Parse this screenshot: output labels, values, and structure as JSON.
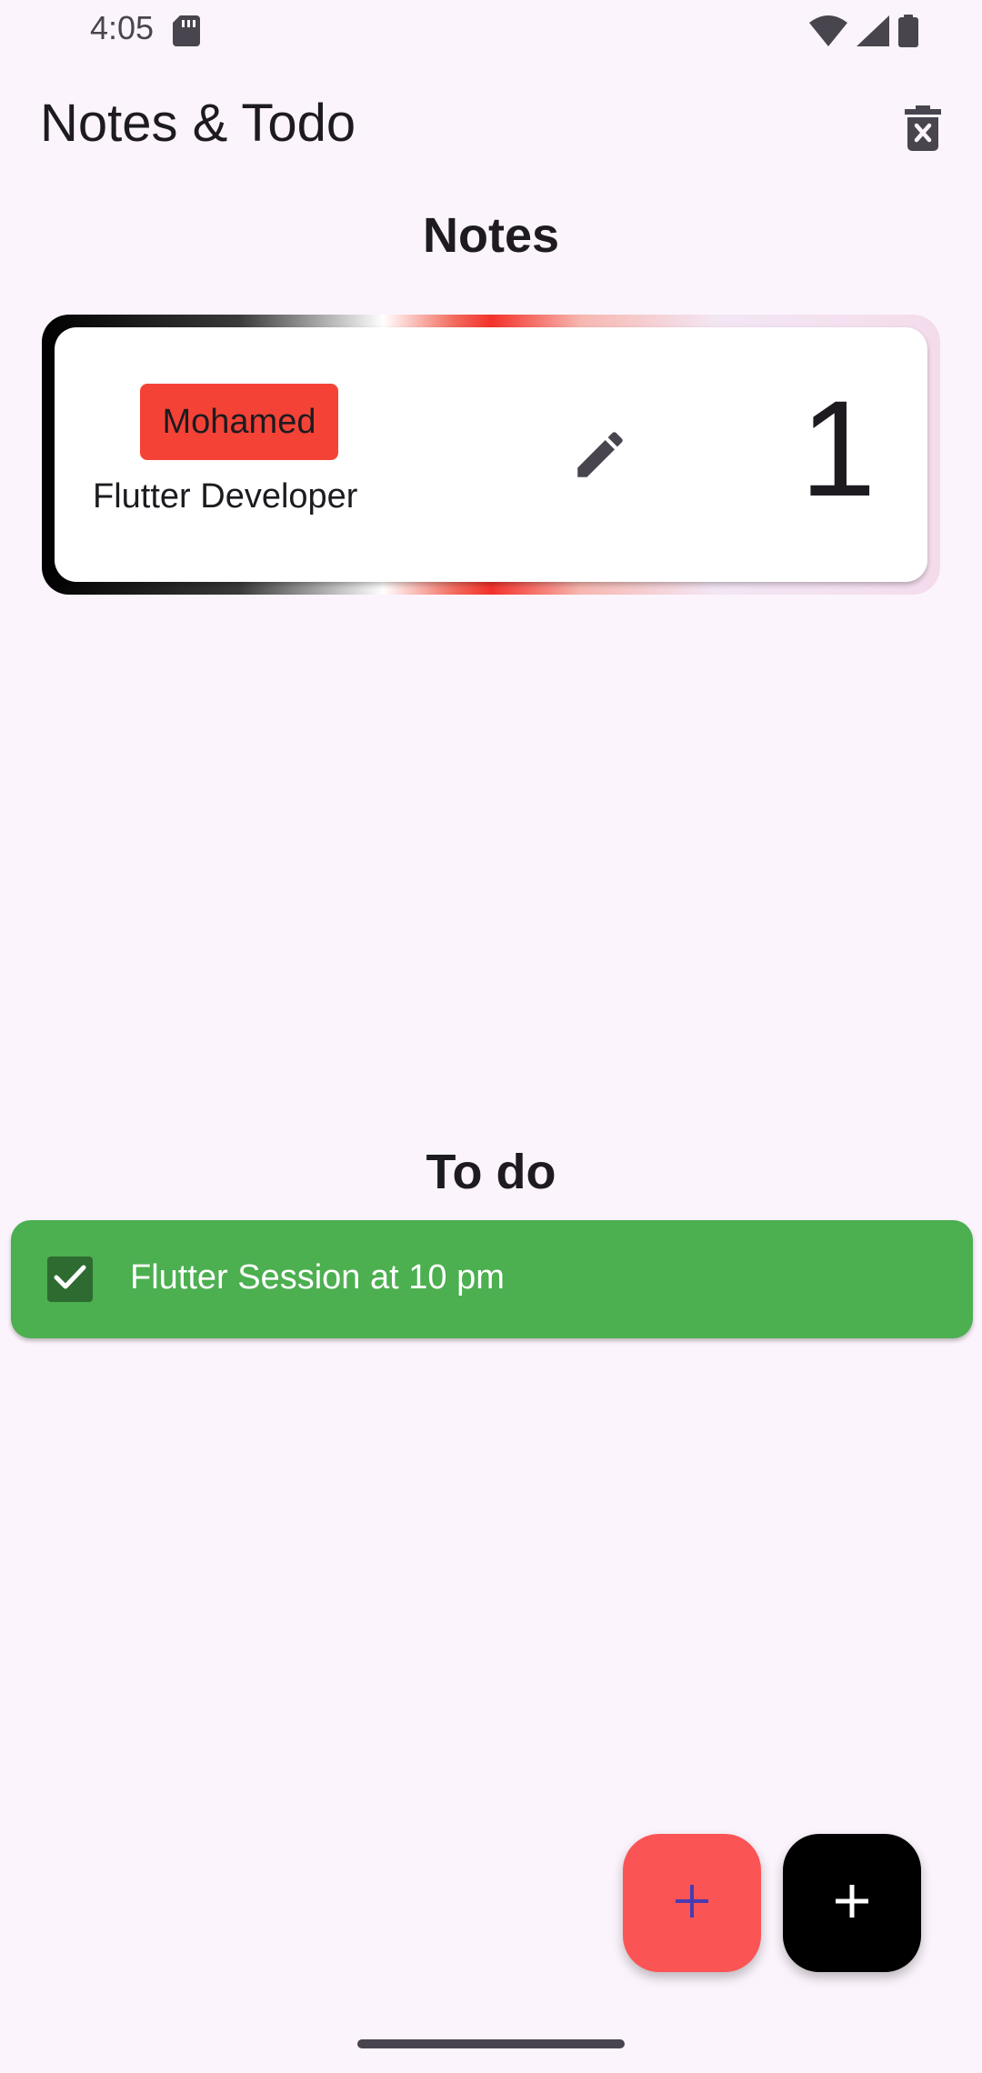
{
  "status_bar": {
    "time": "4:05"
  },
  "app_bar": {
    "title": "Notes & Todo",
    "delete_icon": "delete-forever-icon"
  },
  "notes_section": {
    "title": "Notes",
    "notes": [
      {
        "tag": "Mohamed",
        "subtitle": "Flutter Developer",
        "number": "1",
        "edit_icon": "pencil-icon",
        "tag_color": "#f44336"
      }
    ]
  },
  "todo_section": {
    "title": "To do",
    "items": [
      {
        "text": "Flutter Session at 10 pm",
        "checked": true,
        "color": "#4caf50"
      }
    ]
  },
  "fabs": {
    "add_note_icon": "plus-icon",
    "add_todo_icon": "plus-icon",
    "add_note_color": "#fb5454",
    "add_todo_color": "#000000"
  },
  "colors": {
    "background": "#fcf4fc",
    "note_card_bg": "#ffffff"
  }
}
